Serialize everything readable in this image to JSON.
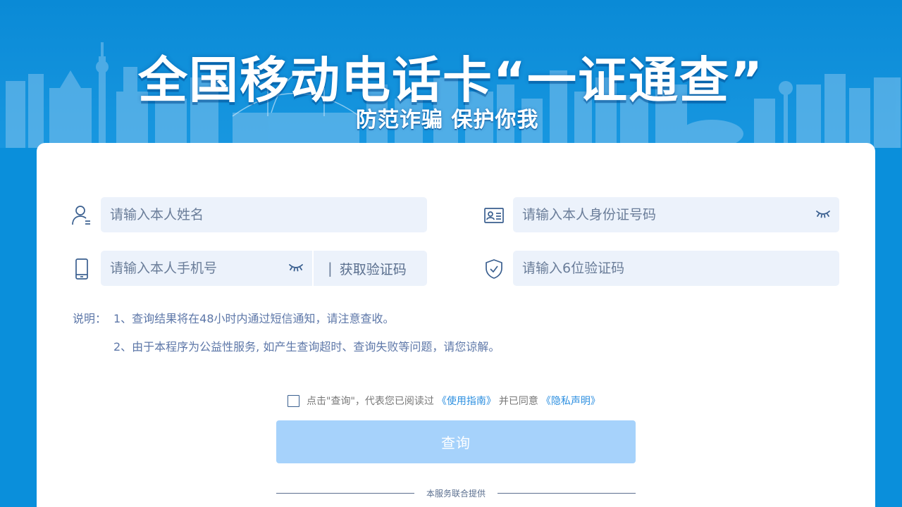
{
  "banner": {
    "title": "全国移动电话卡“一证通查”",
    "subtitle": "防范诈骗 保护你我"
  },
  "form": {
    "name_placeholder": "请输入本人姓名",
    "id_placeholder": "请输入本人身份证号码",
    "phone_placeholder": "请输入本人手机号",
    "get_code_label": "获取验证码",
    "code_placeholder": "请输入6位验证码"
  },
  "notes": {
    "label": "说明：",
    "items": [
      "1、查询结果将在48小时内通过短信通知，请注意查收。",
      "2、由于本程序为公益性服务, 如产生查询超时、查询失败等问题，请您谅解。"
    ]
  },
  "agreement": {
    "prefix": "点击\"查询\"，代表您已阅读过",
    "guide_link": "《使用指南》",
    "middle": "并已同意",
    "privacy_link": "《隐私声明》"
  },
  "query_button": "查询",
  "footer": {
    "provider_text": "本服务联合提供"
  },
  "colors": {
    "background": "#0a8fdb",
    "field_bg": "#ecf2fb",
    "button_disabled": "#a6d2fb",
    "link": "#2c8fe0",
    "icon": "#3a5f8f"
  }
}
